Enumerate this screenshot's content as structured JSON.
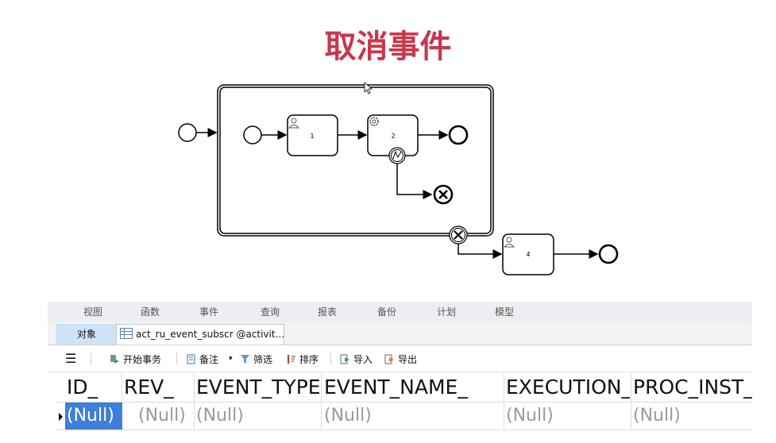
{
  "slide": {
    "title": "取消事件"
  },
  "diagram": {
    "tasks": {
      "t1": "1",
      "t2": "2",
      "t4": "4"
    }
  },
  "app": {
    "menu": [
      "视图",
      "函数",
      "事件",
      "查询",
      "报表",
      "备份",
      "计划",
      "模型"
    ],
    "tabs": {
      "objects": "对象",
      "table": "act_ru_event_subscr @activit..."
    },
    "toolbar": {
      "begin_tx": "开始事务",
      "note": "备注",
      "filter": "筛选",
      "sort": "排序",
      "import": "导入",
      "export": "导出"
    },
    "grid": {
      "columns": [
        "ID_",
        "REV_",
        "EVENT_TYPE_",
        "EVENT_NAME_",
        "EXECUTION_",
        "PROC_INST_"
      ],
      "rows": [
        [
          "(Null)",
          "(Null)",
          "(Null)",
          "(Null)",
          "(Null)",
          "(Null)"
        ]
      ]
    }
  },
  "colors": {
    "title": "#c8374d",
    "selection": "#3d7fd9",
    "tab_active": "#cfe3f8"
  }
}
